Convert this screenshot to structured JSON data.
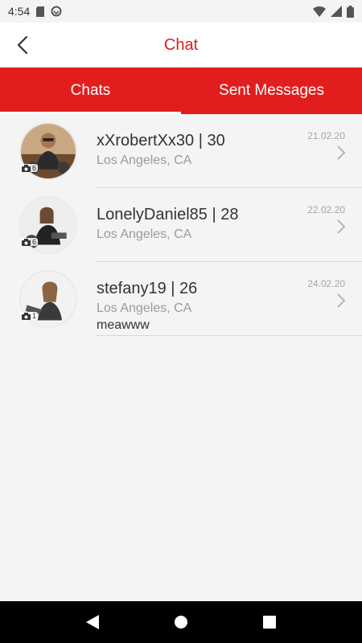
{
  "status_bar": {
    "time": "4:54"
  },
  "header": {
    "title": "Chat",
    "accent_color": "#e21d1d"
  },
  "tabs": [
    {
      "label": "Chats",
      "active": true
    },
    {
      "label": "Sent Messages",
      "active": false
    }
  ],
  "chats": [
    {
      "name": "xXrobertXx30 | 30",
      "location": "Los Angeles, CA",
      "date": "21.02.20",
      "photos": "6",
      "message": ""
    },
    {
      "name": "LonelyDaniel85 | 28",
      "location": "Los Angeles, CA",
      "date": "22.02.20",
      "photos": "6",
      "message": ""
    },
    {
      "name": "stefany19 | 26",
      "location": "Los Angeles, CA",
      "date": "24.02.20",
      "photos": "1",
      "message": "meawww"
    }
  ]
}
